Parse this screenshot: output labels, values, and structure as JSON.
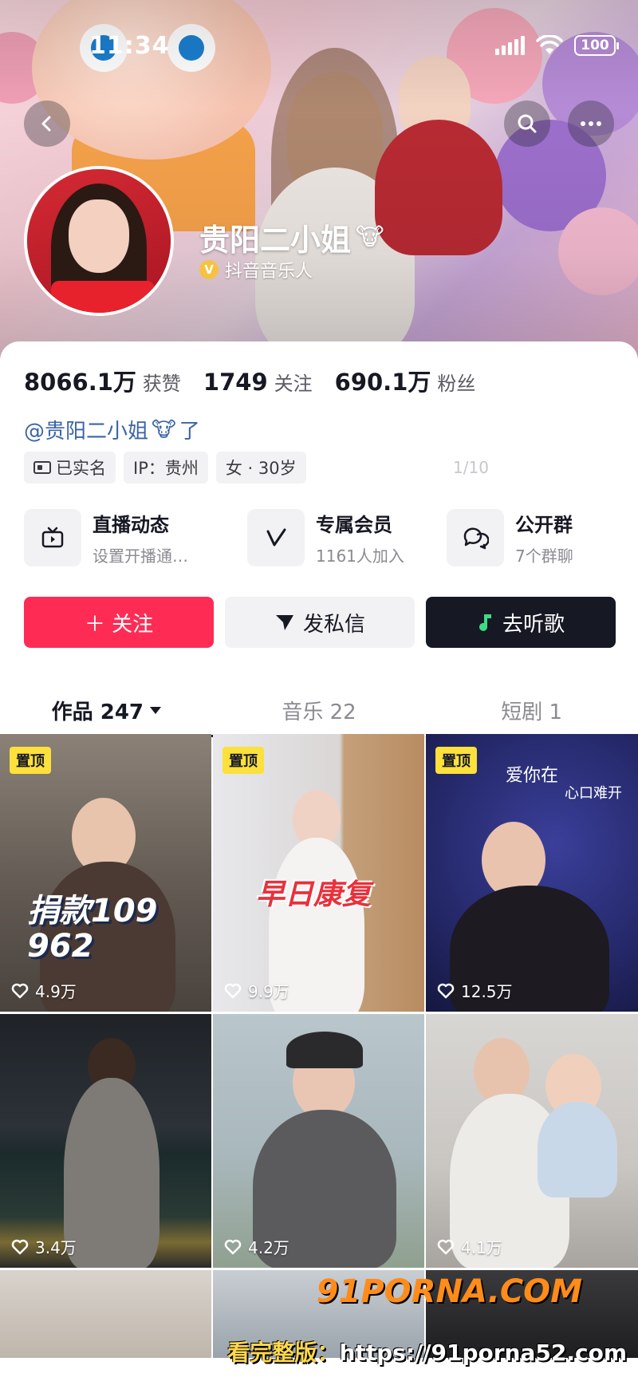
{
  "status_bar": {
    "time": "11:34",
    "battery": "100"
  },
  "header": {
    "nickname": "贵阳二小姐",
    "nickname_emoji": "🐮",
    "verify_badge": "V",
    "verify_label": "抖音音乐人"
  },
  "stats": [
    {
      "value": "8066.1万",
      "label": "获赞"
    },
    {
      "value": "1749",
      "label": "关注"
    },
    {
      "value": "690.1万",
      "label": "粉丝"
    }
  ],
  "bio": {
    "text": "@贵阳二小姐",
    "emoji": "🐮",
    "suffix": "了"
  },
  "tags": [
    {
      "label": "已实名",
      "icon": "id-card-icon"
    },
    {
      "label": "IP：贵州"
    },
    {
      "label": "女 · 30岁"
    }
  ],
  "faded_text": "1/10",
  "features": [
    {
      "title": "直播动态",
      "subtitle": "设置开播通…",
      "icon": "tv-icon"
    },
    {
      "title": "专属会员",
      "subtitle": "1161人加入",
      "icon": "v-icon"
    },
    {
      "title": "公开群",
      "subtitle": "7个群聊",
      "icon": "chat-bubbles-icon"
    }
  ],
  "actions": {
    "follow": "＋ 关注",
    "message": "发私信",
    "music": "去听歌"
  },
  "tabs": [
    {
      "label": "作品 247"
    },
    {
      "label": "音乐 22"
    },
    {
      "label": "短剧 1"
    }
  ],
  "videos": [
    {
      "pinned": "置顶",
      "likes": "4.9万",
      "overlay": "捐款109\n962"
    },
    {
      "pinned": "置顶",
      "likes": "9.9万",
      "overlay": "早日康复"
    },
    {
      "pinned": "置顶",
      "likes": "12.5万",
      "overlay": "爱你在",
      "overlay2": "心口难开"
    },
    {
      "likes": "3.4万"
    },
    {
      "likes": "4.2万"
    },
    {
      "likes": "4.1万"
    }
  ],
  "watermark": {
    "brand": "91PORNA.COM",
    "prefix": "看完整版：",
    "url": "https://91porna52.com"
  },
  "colors": {
    "accent": "#fe2c55",
    "pin": "#fce03b",
    "link": "#3a64a8",
    "dark_button": "#161823"
  }
}
